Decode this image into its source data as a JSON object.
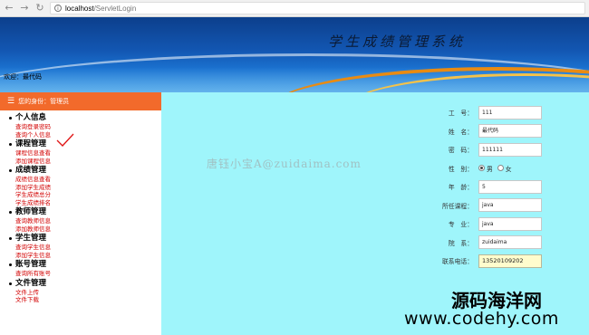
{
  "browser": {
    "url_host": "localhost",
    "url_path": "/ServletLogin"
  },
  "header": {
    "system_title": "学生成绩管理系统",
    "welcome_text": "欢迎：最代码"
  },
  "sidebar": {
    "role_text": "您的身份：管理员",
    "groups": [
      {
        "title": "个人信息",
        "links": [
          "查询登录密码",
          "查询个人信息"
        ]
      },
      {
        "title": "课程管理",
        "links": [
          "课程信息查看",
          "添加课程信息"
        ]
      },
      {
        "title": "成绩管理",
        "links": [
          "成绩信息查看",
          "添加学生成绩",
          "学生成绩总分",
          "学生成绩排名"
        ]
      },
      {
        "title": "教师管理",
        "links": [
          "查询教师信息",
          "添加教师信息"
        ]
      },
      {
        "title": "学生管理",
        "links": [
          "查询学生信息",
          "添加学生信息"
        ]
      },
      {
        "title": "账号管理",
        "links": [
          "查询所有账号"
        ]
      },
      {
        "title": "文件管理",
        "links": [
          "文件上传",
          "文件下载"
        ]
      }
    ]
  },
  "form": {
    "fields": [
      {
        "label": "工　号：",
        "value": "111"
      },
      {
        "label": "姓　名：",
        "value": "最代码"
      },
      {
        "label": "密　码：",
        "value": "111111"
      },
      {
        "label": "性　别：",
        "male": "男",
        "female": "女",
        "selected": "男"
      },
      {
        "label": "年　龄：",
        "value": "5"
      },
      {
        "label": "所任课程：",
        "value": "java"
      },
      {
        "label": "专　业：",
        "value": "java"
      },
      {
        "label": "院　系：",
        "value": "zuidaima"
      },
      {
        "label": "联系电话：",
        "value": "13520109202"
      }
    ]
  },
  "watermarks": {
    "center": "唐钰小宝A@zuidaima.com",
    "brand_cn": "源码海洋网",
    "brand_url": "www.codehy.com"
  },
  "colors": {
    "role_bar": "#f26a2b",
    "content_bg": "#9ff5fb",
    "link": "#d20000",
    "phone_bg": "#fffccd"
  }
}
